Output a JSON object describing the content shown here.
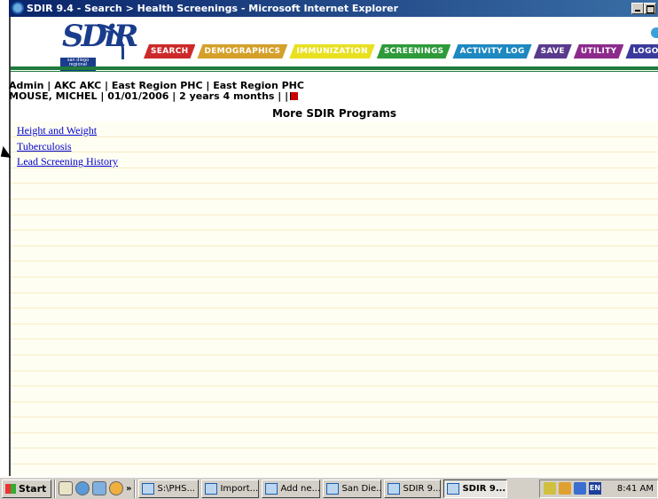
{
  "window": {
    "title": "SDIR 9.4 - Search > Health Screenings - Microsoft Internet Explorer"
  },
  "logo": {
    "text": "SDiR",
    "subtext": "san diego regional immunization registry"
  },
  "nav": {
    "tabs": [
      {
        "label": "Search",
        "color": "#cc2a2a"
      },
      {
        "label": "Demographics",
        "color": "#d4a02a"
      },
      {
        "label": "Immunization",
        "color": "#e8e020"
      },
      {
        "label": "Screenings",
        "color": "#2e9a3a"
      },
      {
        "label": "Activity Log",
        "color": "#1e88c0"
      },
      {
        "label": "Save",
        "color": "#5a3a8c"
      },
      {
        "label": "Utility",
        "color": "#8c2a8c"
      },
      {
        "label": "Logout",
        "color": "#3a3a9c"
      }
    ]
  },
  "user": {
    "line1": "Admin | AKC AKC | East Region PHC | East Region PHC",
    "line2": "MOUSE, MICHEL | 01/01/2006 | 2 years 4 months | |"
  },
  "page": {
    "title": "More SDIR Programs",
    "links": [
      "Height and Weight",
      "Tuberculosis",
      "Lead Screening History"
    ]
  },
  "taskbar": {
    "start": "Start",
    "chevron": "»",
    "tasks": [
      {
        "label": "S:\\PHS...",
        "active": false
      },
      {
        "label": "Import...",
        "active": false
      },
      {
        "label": "Add ne...",
        "active": false
      },
      {
        "label": "San Die...",
        "active": false
      },
      {
        "label": "SDIR 9...",
        "active": false
      },
      {
        "label": "SDIR 9...",
        "active": true
      }
    ],
    "lang": "EN",
    "clock": "8:41 AM"
  }
}
